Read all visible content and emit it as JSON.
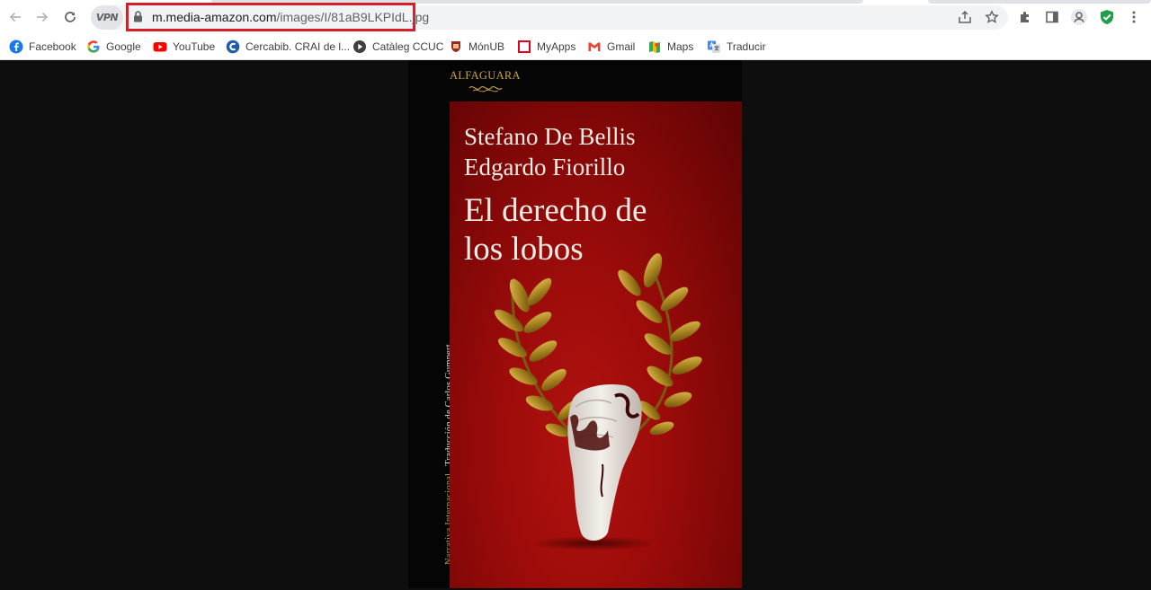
{
  "browser": {
    "nav": {
      "back_icon": "arrow-left-icon",
      "forward_icon": "arrow-right-icon",
      "reload_icon": "reload-icon"
    },
    "vpn_label": "VPN",
    "address": {
      "host": "m.media-amazon.com",
      "path": "/images/I/81aB9LKPIdL.jpg",
      "highlight_color": "#d31f2a"
    },
    "right_icons": [
      "share-icon",
      "star-icon",
      "extensions-icon",
      "side-panel-icon",
      "profile-icon",
      "shield-extension-icon",
      "menu-icon"
    ]
  },
  "bookmarks": [
    {
      "label": "Facebook",
      "icon": "facebook-icon"
    },
    {
      "label": "Google",
      "icon": "google-icon"
    },
    {
      "label": "YouTube",
      "icon": "youtube-icon"
    },
    {
      "label": "Cercabib. CRAI de l...",
      "icon": "crai-icon"
    },
    {
      "label": "Catàleg CCUC",
      "icon": "play-circle-icon"
    },
    {
      "label": "MónUB",
      "icon": "monub-icon"
    },
    {
      "label": "MyApps",
      "icon": "myapps-icon"
    },
    {
      "label": "Gmail",
      "icon": "gmail-icon"
    },
    {
      "label": "Maps",
      "icon": "maps-icon"
    },
    {
      "label": "Traducir",
      "icon": "translate-icon"
    }
  ],
  "book_cover": {
    "publisher": "ALFAGUARA",
    "author_1": "Stefano De Bellis",
    "author_2": "Edgardo Fiorillo",
    "title_line_1": "El derecho de",
    "title_line_2": "los lobos",
    "spine_series": "Narrativa Internacional",
    "spine_translation": "Traducción de Carlos Gumpert",
    "colors": {
      "background": "#9d0c0a",
      "text": "#f4ece4",
      "gold": "#c69b3a"
    }
  }
}
